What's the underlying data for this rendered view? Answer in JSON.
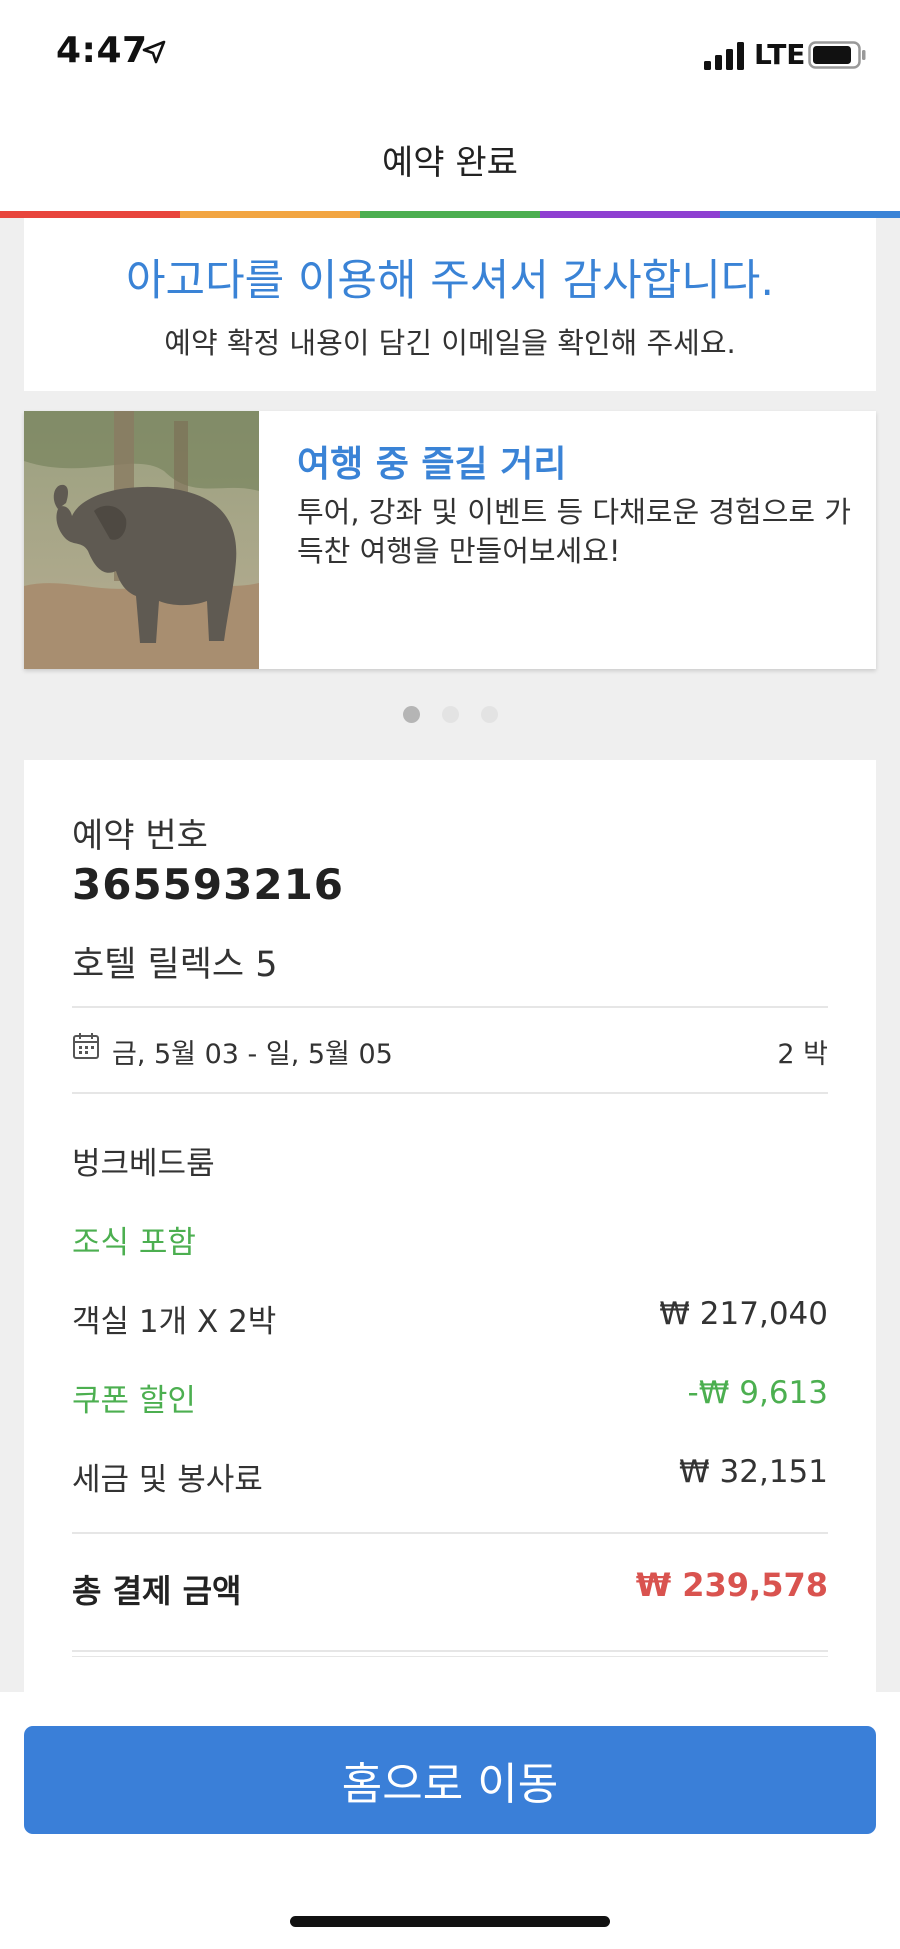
{
  "status_bar": {
    "time": "4:47",
    "network": "LTE"
  },
  "header": {
    "title": "예약 완료"
  },
  "rainbow_colors": [
    "#e8453c",
    "#f2a541",
    "#4caf50",
    "#8e3fd1",
    "#3a83d6"
  ],
  "thanks": {
    "title": "아고다를 이용해 주셔서 감사합니다.",
    "subtitle": "예약 확정 내용이 담긴 이메일을 확인해 주세요."
  },
  "promo": {
    "title": "여행 중 즐길 거리",
    "description": "투어, 강좌 및 이벤트 등 다채로운 경험으로 가득찬 여행을 만들어보세요!",
    "image": "elephant-photo"
  },
  "carousel": {
    "total": 3,
    "active_index": 0
  },
  "booking": {
    "number_label": "예약 번호",
    "number": "365593216",
    "hotel": "호텔 릴렉스 5",
    "dates": "금, 5월 03 - 일, 5월 05",
    "nights": "2 박",
    "room_type": "벙크베드룸",
    "breakfast": "조식 포함",
    "price_rows": [
      {
        "label": "객실 1개 X 2박",
        "value": "₩ 217,040",
        "color": "#333333"
      },
      {
        "label": "쿠폰 할인",
        "value": "-₩ 9,613",
        "color": "#4caf50"
      },
      {
        "label": "세금 및 봉사료",
        "value": "₩ 32,151",
        "color": "#333333"
      }
    ],
    "total_label": "총 결제 금액",
    "total_value": "₩ 239,578"
  },
  "bottom": {
    "home_button": "홈으로 이동"
  },
  "colors": {
    "accent": "#3a83d6",
    "button": "#3a7fd8",
    "success": "#4caf50",
    "total": "#d9534f"
  }
}
